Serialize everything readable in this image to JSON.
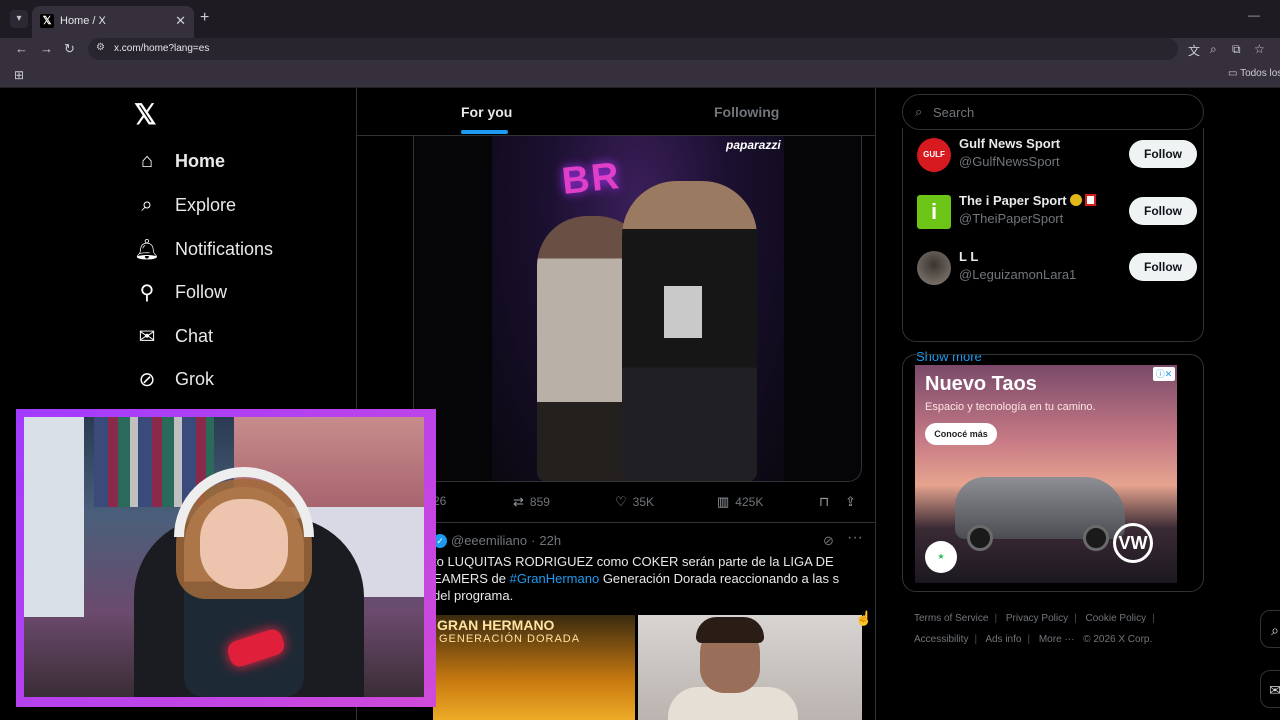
{
  "browser": {
    "tab_title": "Home / X",
    "tab_favicon": "𝕏",
    "url": "x.com/home?lang=es",
    "bookmarks_folder": "Todos los"
  },
  "nav": {
    "logo": "𝕏",
    "items": [
      {
        "label": "Home",
        "icon": "home-icon"
      },
      {
        "label": "Explore",
        "icon": "search-icon"
      },
      {
        "label": "Notifications",
        "icon": "bell-icon"
      },
      {
        "label": "Follow",
        "icon": "follow-user-icon"
      },
      {
        "label": "Chat",
        "icon": "envelope-icon"
      },
      {
        "label": "Grok",
        "icon": "grok-icon"
      }
    ]
  },
  "feed": {
    "tabs": [
      "For you",
      "Following"
    ],
    "post1": {
      "image_watermark": "paparazzi",
      "neon_sign": "BR",
      "replies": "26",
      "reposts": "859",
      "likes": "35K",
      "views": "425K"
    },
    "post2": {
      "handle": "@eeemiliano",
      "time": "22h",
      "text_before": "to LUQUITAS RODRIGUEZ como COKER serán parte de la LIGA DE EAMERS de ",
      "hashtag": "#GranHermano",
      "text_after": " Generación Dorada reaccionando a las s del programa.",
      "media1_title": "GRAN HERMANO",
      "media1_sub": "GENERACIÓN DORADA"
    }
  },
  "sidebar": {
    "search_placeholder": "Search",
    "who_to_follow": [
      {
        "name": "Gulf News Sport",
        "handle": "@GulfNewsSport",
        "button": "Follow",
        "avatar_text": "GULF NEWS",
        "avatar_color": "#d71920"
      },
      {
        "name": "The i Paper Sport",
        "handle": "@TheiPaperSport",
        "button": "Follow",
        "avatar_text": "i",
        "avatar_color": "#6cc417"
      },
      {
        "name": "L L",
        "handle": "@LeguizamonLara1",
        "button": "Follow",
        "avatar_text": "",
        "avatar_color": "#6b6259"
      }
    ],
    "show_more": "Show more",
    "ad": {
      "title": "Nuevo Taos",
      "subtitle": "Espacio y tecnología en tu camino.",
      "cta": "Conocé más",
      "brand": "VW"
    },
    "footer": [
      "Terms of Service",
      "Privacy Policy",
      "Cookie Policy",
      "Accessibility",
      "Ads info",
      "More ···",
      "© 2026 X Corp."
    ]
  },
  "colors": {
    "accent": "#1d9bf0",
    "cam_border": "#a23bff"
  }
}
